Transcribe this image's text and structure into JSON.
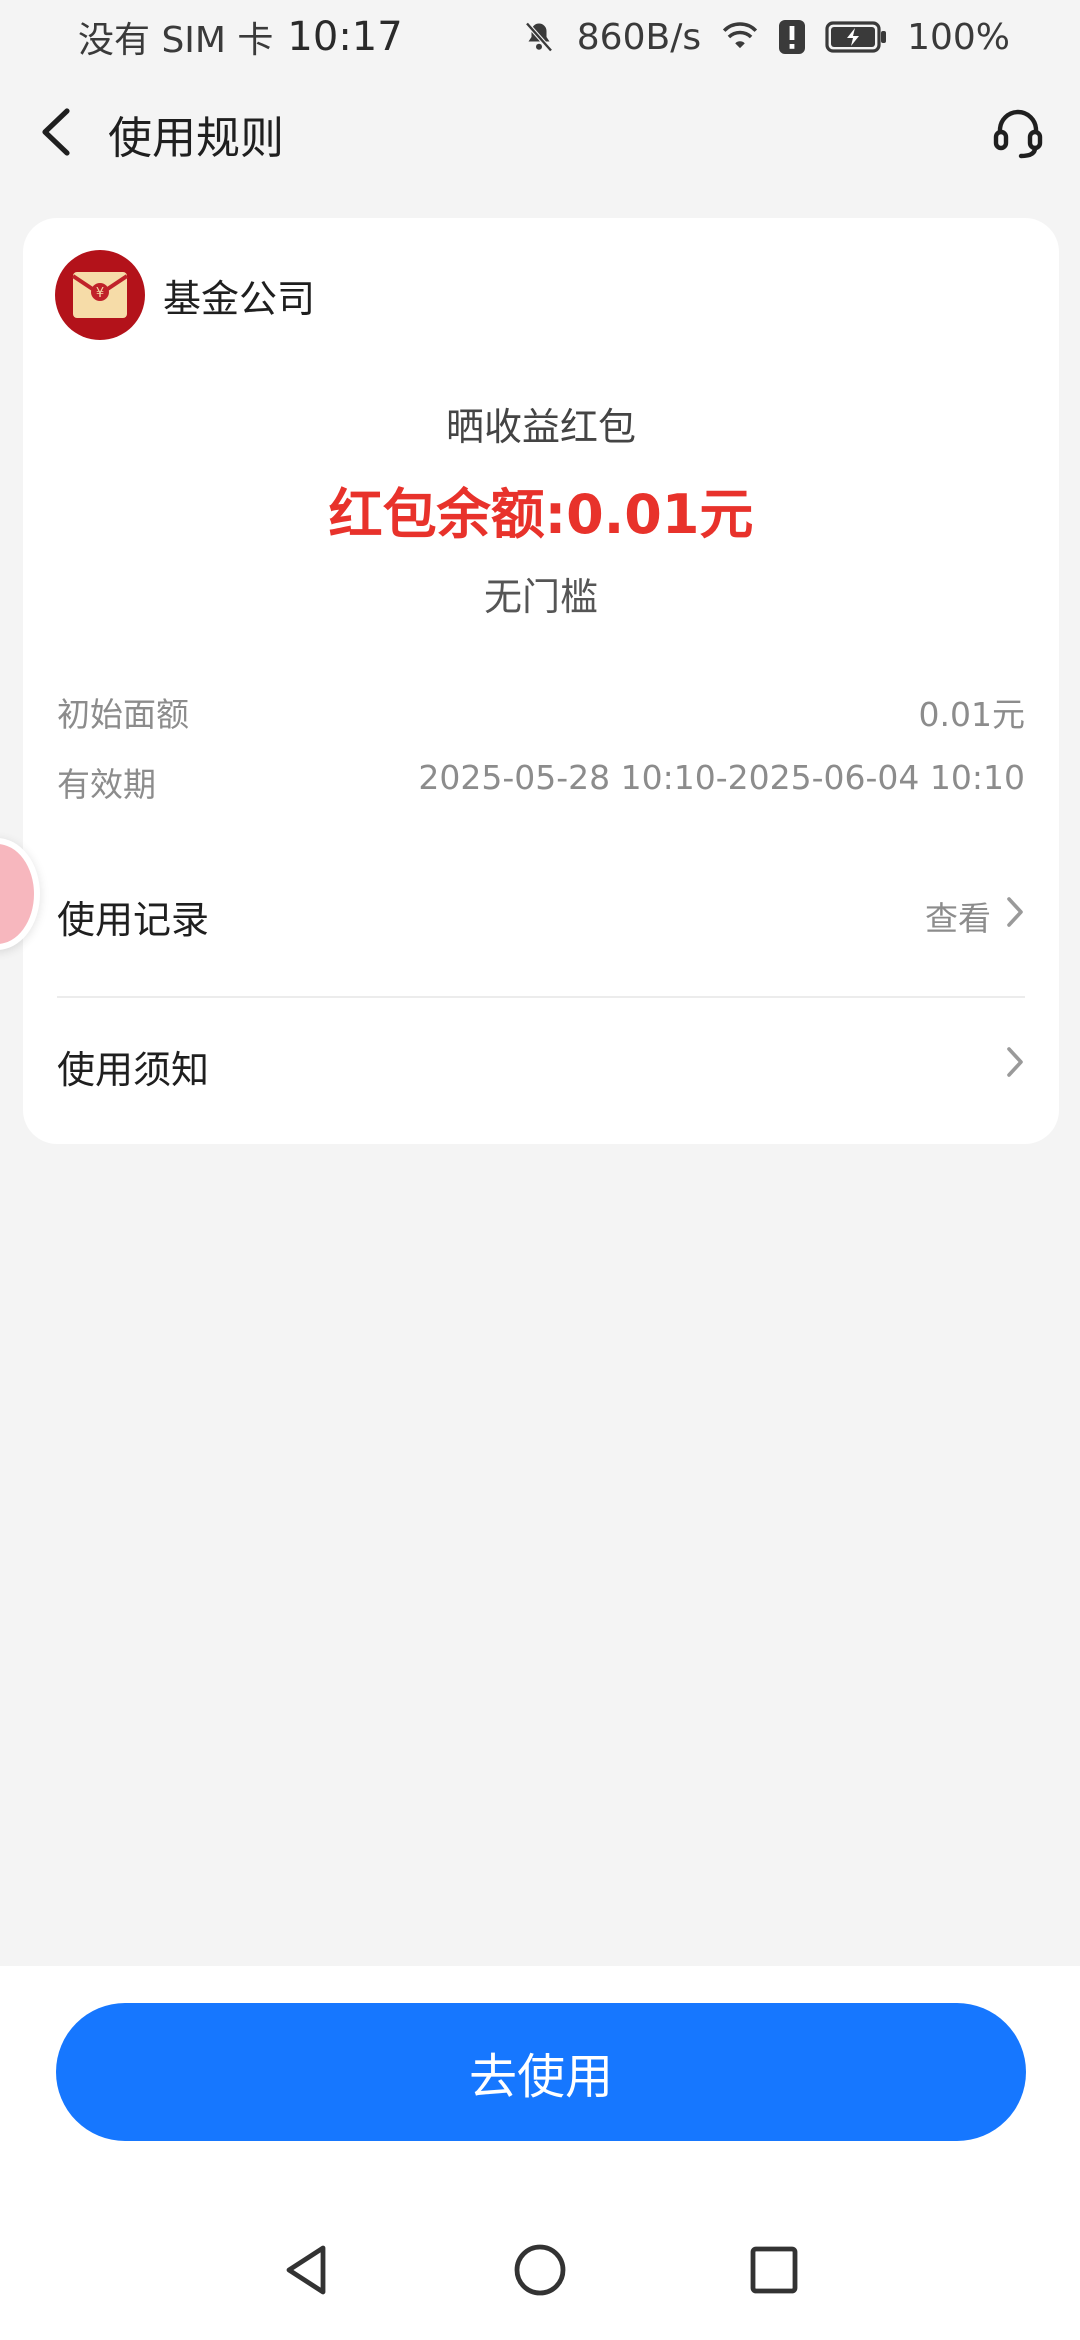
{
  "status_bar": {
    "carrier": "没有 SIM 卡",
    "time": "10:17",
    "net_speed": "860B/s",
    "battery": "100%",
    "icons": [
      "mute-bell-icon",
      "wifi-icon",
      "alert-icon",
      "battery-charging-icon"
    ]
  },
  "header": {
    "title": "使用规则",
    "back_icon": "chevron-left-icon",
    "support_icon": "headset-icon"
  },
  "card": {
    "brand_name": "基金公司",
    "brand_logo_icon": "red-envelope-icon",
    "coupon_name": "晒收益红包",
    "balance": "红包余额:0.01元",
    "threshold": "无门槛",
    "info": [
      {
        "label": "初始面额",
        "value": "0.01元"
      },
      {
        "label": "有效期",
        "value": "2025-05-28 10:10-2025-06-04 10:10"
      }
    ],
    "links": [
      {
        "label": "使用记录",
        "action": "查看"
      },
      {
        "label": "使用须知",
        "action": ""
      }
    ]
  },
  "primary_button": {
    "label": "去使用"
  },
  "colors": {
    "accent": "#1677ff",
    "balance_red": "#e8322b",
    "logo_red": "#b3121a",
    "background": "#f4f4f4"
  },
  "nav": [
    "back-triangle-icon",
    "home-circle-icon",
    "recents-square-icon"
  ]
}
